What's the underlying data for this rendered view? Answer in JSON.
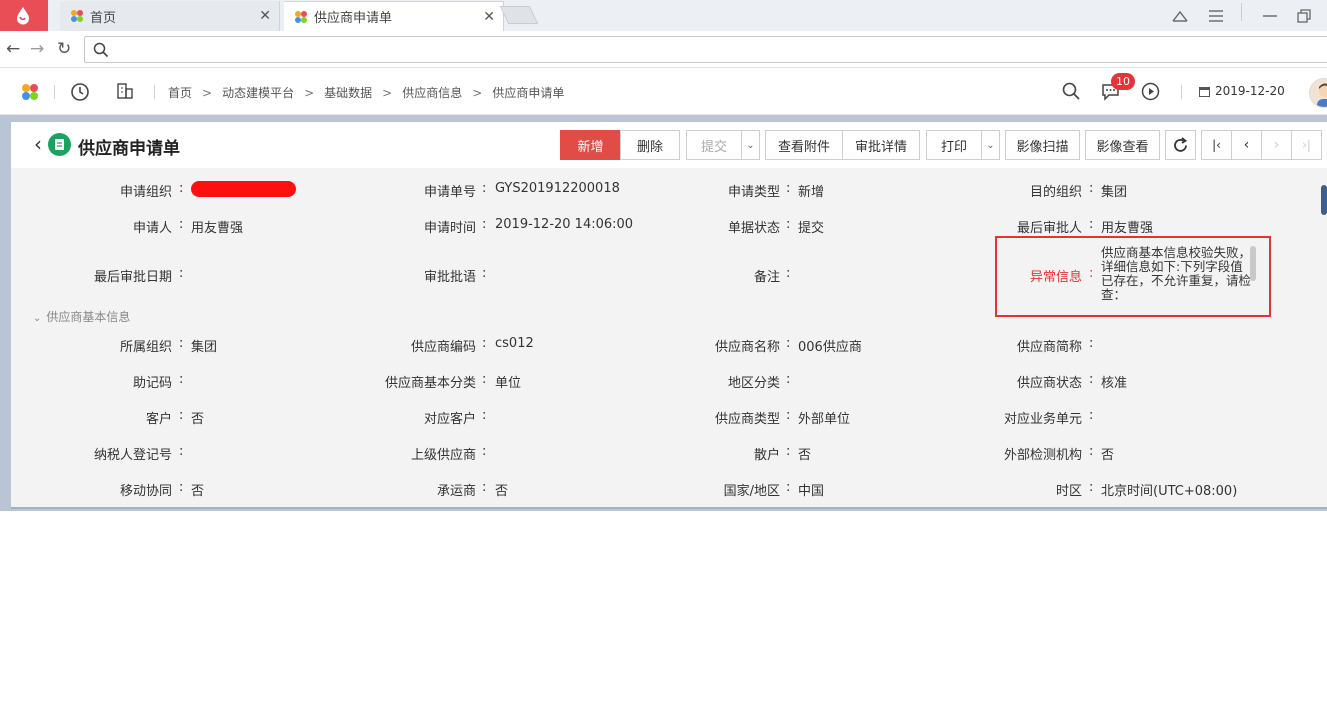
{
  "browser": {
    "tabs": [
      {
        "label": "首页"
      },
      {
        "label": "供应商申请单"
      }
    ]
  },
  "header": {
    "breadcrumb": [
      "首页",
      "动态建模平台",
      "基础数据",
      "供应商信息",
      "供应商申请单"
    ],
    "notification_count": "10",
    "date": "2019-12-20"
  },
  "page": {
    "title": "供应商申请单",
    "toolbar": {
      "add": "新增",
      "delete": "删除",
      "submit": "提交",
      "view_attachment": "查看附件",
      "approval_details": "审批详情",
      "print": "打印",
      "image_scan": "影像扫描",
      "image_view": "影像查看"
    }
  },
  "form": {
    "rows": [
      [
        {
          "label": "申请组织",
          "value": ""
        },
        {
          "label": "申请单号",
          "value": "GYS201912200018"
        },
        {
          "label": "申请类型",
          "value": "新增"
        },
        {
          "label": "目的组织",
          "value": "集团"
        }
      ],
      [
        {
          "label": "申请人",
          "value": "用友曹强"
        },
        {
          "label": "申请时间",
          "value": "2019-12-20 14:06:00"
        },
        {
          "label": "单据状态",
          "value": "提交"
        },
        {
          "label": "最后审批人",
          "value": "用友曹强"
        }
      ],
      [
        {
          "label": "最后审批日期",
          "value": ""
        },
        {
          "label": "审批批语",
          "value": ""
        },
        {
          "label": "备注",
          "value": ""
        },
        {
          "label": "异常信息",
          "value": "供应商基本信息校验失败，详细信息如下:下列字段值已存在，不允许重复，请检查："
        }
      ]
    ],
    "section_title": "供应商基本信息",
    "basic_rows": [
      [
        {
          "label": "所属组织",
          "value": "集团"
        },
        {
          "label": "供应商编码",
          "value": "cs012"
        },
        {
          "label": "供应商名称",
          "value": "006供应商"
        },
        {
          "label": "供应商简称",
          "value": ""
        }
      ],
      [
        {
          "label": "助记码",
          "value": ""
        },
        {
          "label": "供应商基本分类",
          "value": "单位"
        },
        {
          "label": "地区分类",
          "value": ""
        },
        {
          "label": "供应商状态",
          "value": "核准"
        }
      ],
      [
        {
          "label": "客户",
          "value": "否"
        },
        {
          "label": "对应客户",
          "value": ""
        },
        {
          "label": "供应商类型",
          "value": "外部单位"
        },
        {
          "label": "对应业务单元",
          "value": ""
        }
      ],
      [
        {
          "label": "纳税人登记号",
          "value": ""
        },
        {
          "label": "上级供应商",
          "value": ""
        },
        {
          "label": "散户",
          "value": "否"
        },
        {
          "label": "外部检测机构",
          "value": "否"
        }
      ],
      [
        {
          "label": "移动协同",
          "value": "否"
        },
        {
          "label": "承运商",
          "value": "否"
        },
        {
          "label": "国家/地区",
          "value": "中国"
        },
        {
          "label": "时区",
          "value": "北京时间(UTC+08:00)"
        }
      ]
    ]
  },
  "colors": {
    "accent_red": "#e14c46",
    "error_red": "#e3342f",
    "title_icon_green": "#1aa260"
  }
}
